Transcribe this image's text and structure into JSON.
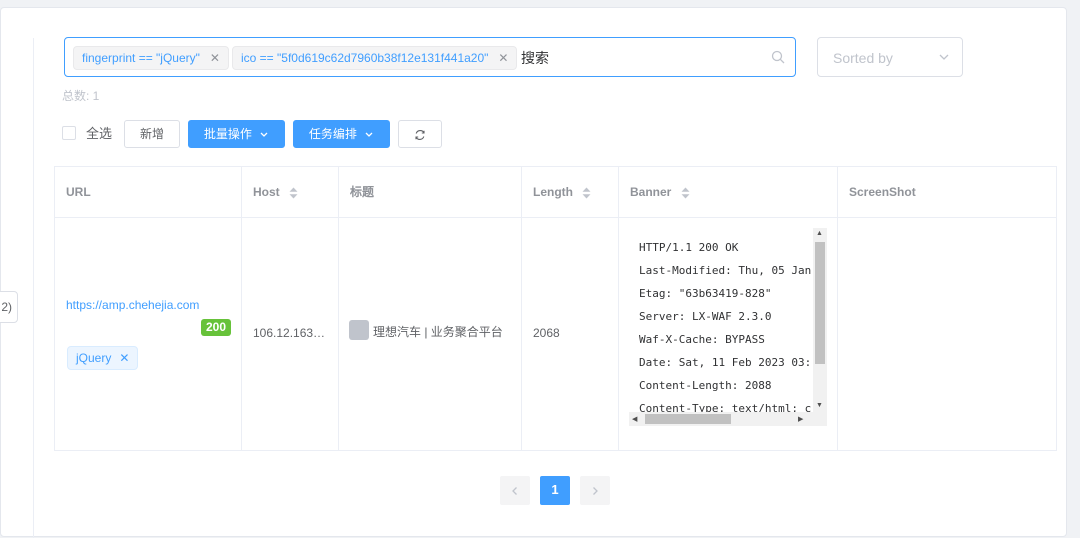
{
  "search": {
    "tags": [
      {
        "label": "fingerprint == \"jQuery\""
      },
      {
        "label": "ico == \"5f0d619c62d7960b38f12e131f441a20\""
      }
    ],
    "typed": "搜索"
  },
  "sort": {
    "placeholder": "Sorted by"
  },
  "total": "总数: 1",
  "toolbar": {
    "select_all": "全选",
    "add": "新增",
    "batch": "批量操作",
    "task": "任务编排"
  },
  "edge_button": "2)",
  "table": {
    "headers": [
      "URL",
      "Host",
      "标题",
      "Length",
      "Banner",
      "ScreenShot"
    ],
    "row": {
      "url": "https://amp.chehejia.com",
      "status": "200",
      "fingerprint_tag": "jQuery",
      "host": "106.12.163…",
      "title": "理想汽车 | 业务聚合平台",
      "length": "2068",
      "banner": [
        "HTTP/1.1 200 OK",
        "Last-Modified: Thu, 05 Jan",
        "Etag: \"63b63419-828\"",
        "Server: LX-WAF 2.3.0",
        "Waf-X-Cache: BYPASS",
        "Date: Sat, 11 Feb 2023 03:",
        "Content-Length: 2088",
        "Content-Type: text/html; c"
      ]
    }
  },
  "pagination": {
    "current": "1"
  },
  "colors": {
    "primary": "#409eff",
    "success": "#67c23a"
  }
}
